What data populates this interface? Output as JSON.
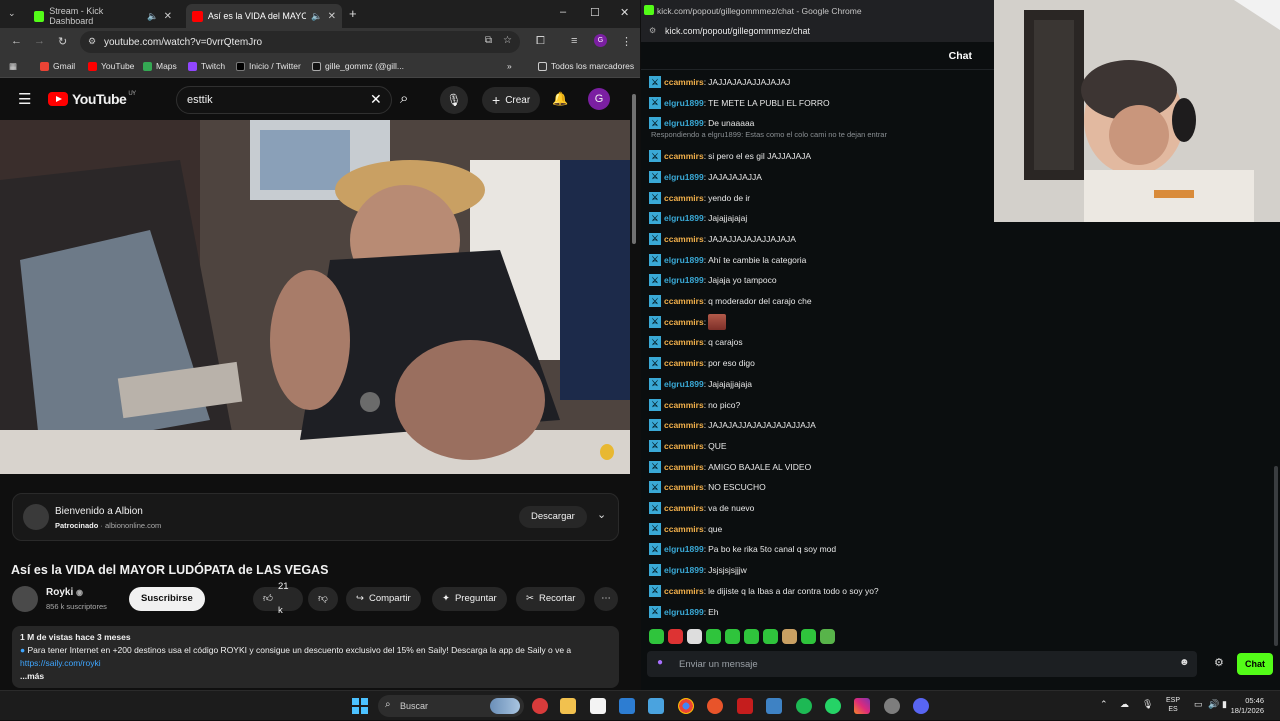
{
  "left_window": {
    "tabs": [
      {
        "label": "Stream - Kick Dashboard",
        "active": false
      },
      {
        "label": "Así es la VIDA del MAYOR LUDÓPATA DE LAS VEGAS",
        "active": true
      }
    ],
    "url": "youtube.com/watch?v=0vrrQtemJro",
    "bookmarks": [
      "Gmail",
      "YouTube",
      "Maps",
      "Twitch",
      "Inicio / Twitter",
      "gille_gommz (@gill...",
      "Todos los marcadores"
    ]
  },
  "youtube": {
    "logo_text": "YouTube",
    "logo_region": "UY",
    "search_value": "esttik",
    "create_label": "Crear",
    "avatar_letter": "G",
    "sponsor": {
      "title": "Bienvenido a Albion",
      "sponsored_label": "Patrocinado",
      "domain": "albiononline.com",
      "download_label": "Descargar"
    },
    "video_title": "Así es la VIDA del MAYOR LUDÓPATA de LAS VEGAS",
    "channel": {
      "name": "Royki",
      "subscribers": "856 k suscriptores"
    },
    "subscribe_label": "Suscribirse",
    "likes": "21 k",
    "share_label": "Compartir",
    "ask_label": "Preguntar",
    "clip_label": "Recortar",
    "description": {
      "meta": "1 M de vistas  hace 3 meses",
      "text": "Para tener Internet en +200 destinos usa el código ROYKI y consigue un descuento exclusivo del 15% en Saily! Descarga la app de Saily o ve a",
      "link": "https://saily.com/royki",
      "more": "...más"
    }
  },
  "right_window": {
    "title": "kick.com/popout/gillegommmez/chat - Google Chrome",
    "url": "kick.com/popout/gillegommmez/chat",
    "chat_header": "Chat",
    "reply_note": "Respondiendo a elgru1899: Estas como el colo cami no te dejan entrar",
    "messages": [
      {
        "user": "ccammirs",
        "text": "JAJJAJAJAJJAJAJAJ",
        "color": "#f2b04b"
      },
      {
        "user": "elgru1899",
        "text": "TE METE LA PUBLI EL FORRO",
        "color": "#3aa9d6"
      },
      {
        "user": "elgru1899",
        "text": "De unaaaaa",
        "color": "#3aa9d6"
      },
      {
        "user": "ccammirs",
        "text": "si pero el es gil JAJJAJAJA",
        "color": "#f2b04b"
      },
      {
        "user": "elgru1899",
        "text": "JAJAJAJAJJA",
        "color": "#3aa9d6"
      },
      {
        "user": "ccammirs",
        "text": "yendo de ir",
        "color": "#f2b04b"
      },
      {
        "user": "elgru1899",
        "text": "Jajajjajajaj",
        "color": "#3aa9d6"
      },
      {
        "user": "ccammirs",
        "text": "JAJAJJAJAJAJJAJAJA",
        "color": "#f2b04b"
      },
      {
        "user": "elgru1899",
        "text": "Ahí te cambie la categoria",
        "color": "#3aa9d6"
      },
      {
        "user": "elgru1899",
        "text": "Jajaja yo tampoco",
        "color": "#3aa9d6"
      },
      {
        "user": "ccammirs",
        "text": "q moderador del carajo che",
        "color": "#f2b04b"
      },
      {
        "user": "ccammirs",
        "text": "",
        "color": "#f2b04b",
        "emote": true
      },
      {
        "user": "ccammirs",
        "text": "q carajos",
        "color": "#f2b04b"
      },
      {
        "user": "ccammirs",
        "text": "por eso digo",
        "color": "#f2b04b"
      },
      {
        "user": "elgru1899",
        "text": "Jajajajjajaja",
        "color": "#3aa9d6"
      },
      {
        "user": "ccammirs",
        "text": "no pico?",
        "color": "#f2b04b"
      },
      {
        "user": "ccammirs",
        "text": "JAJAJAJJAJAJAJAJAJJAJA",
        "color": "#f2b04b"
      },
      {
        "user": "ccammirs",
        "text": "QUE",
        "color": "#f2b04b"
      },
      {
        "user": "ccammirs",
        "text": "AMIGO BAJALE AL VIDEO",
        "color": "#f2b04b"
      },
      {
        "user": "ccammirs",
        "text": "NO ESCUCHO",
        "color": "#f2b04b"
      },
      {
        "user": "ccammirs",
        "text": "va de nuevo",
        "color": "#f2b04b"
      },
      {
        "user": "ccammirs",
        "text": "que",
        "color": "#f2b04b"
      },
      {
        "user": "elgru1899",
        "text": "Pa bo ke rika 5to canal q soy mod",
        "color": "#3aa9d6"
      },
      {
        "user": "elgru1899",
        "text": "Jsjsjsjsjjjw",
        "color": "#3aa9d6"
      },
      {
        "user": "ccammirs",
        "text": "le dijiste q la Ibas a dar contra todo o soy yo?",
        "color": "#f2b04b"
      },
      {
        "user": "elgru1899",
        "text": "Eh",
        "color": "#3aa9d6"
      }
    ],
    "input_placeholder": "Enviar un mensaje",
    "send_label": "Chat"
  },
  "taskbar": {
    "search_placeholder": "Buscar",
    "lang_top": "ESP",
    "lang_bottom": "ES",
    "time": "05:46",
    "date": "18/1/2026"
  }
}
